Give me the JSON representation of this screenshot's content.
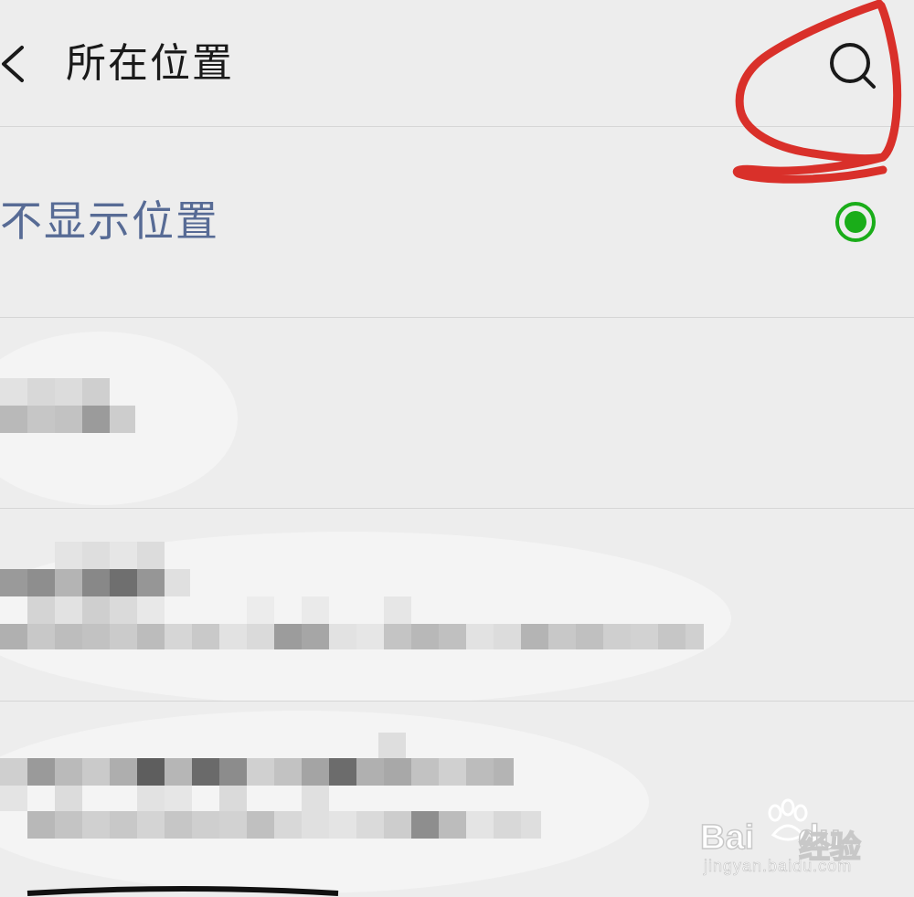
{
  "header": {
    "back_icon": "chevron-left-icon",
    "title": "所在位置",
    "search_icon": "search-icon"
  },
  "annotation": {
    "color": "#d9302a"
  },
  "options": {
    "no_location": {
      "label": "不显示位置",
      "selected": true,
      "selected_color": "#1aad19"
    }
  },
  "location_items": [
    {
      "name": "",
      "address": ""
    },
    {
      "name": "",
      "address": ""
    },
    {
      "name": "",
      "address": ""
    }
  ],
  "watermark": {
    "brand": "Bai",
    "brand_tail": "du",
    "product": "经验",
    "url": "jingyan.baidu.com"
  }
}
